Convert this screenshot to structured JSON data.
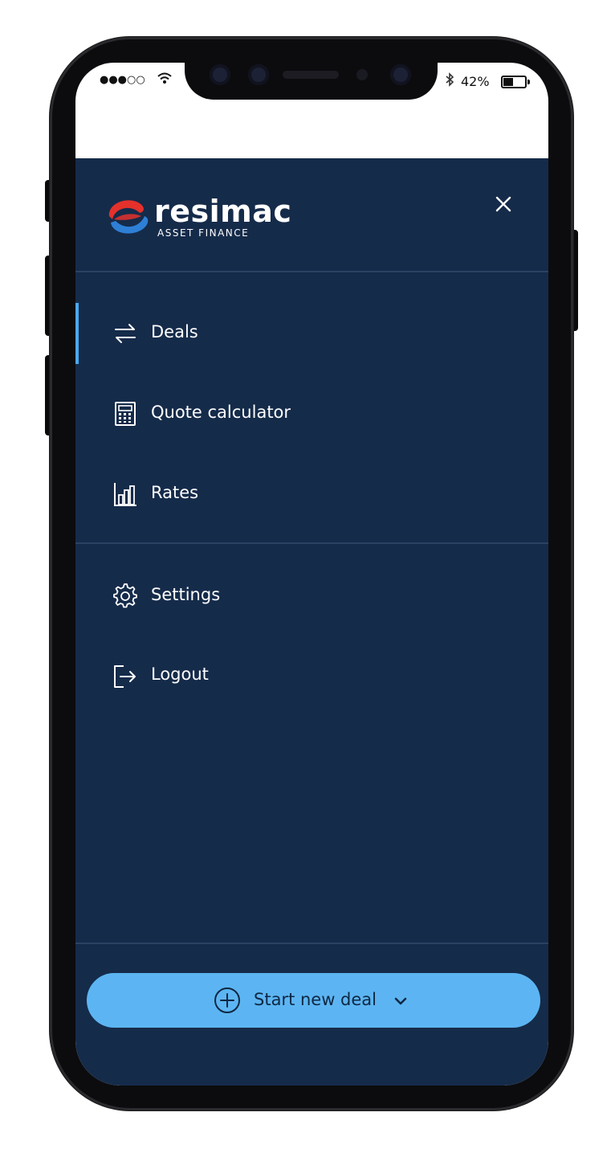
{
  "status_bar": {
    "signal": "●●●○○",
    "wifi_icon": "wifi-icon",
    "bluetooth_icon": "bluetooth-icon",
    "battery_percent": "42%"
  },
  "brand": {
    "name": "resimac",
    "subtitle": "ASSET FINANCE",
    "colors": {
      "red": "#e4312b",
      "blue": "#2e7fd6",
      "navy": "#152b4a"
    }
  },
  "drawer": {
    "close_icon": "close-icon",
    "menu": [
      {
        "label": "Deals",
        "icon": "swap-arrows-icon",
        "active": true
      },
      {
        "label": "Quote calculator",
        "icon": "calculator-icon",
        "active": false
      },
      {
        "label": "Rates",
        "icon": "bar-chart-icon",
        "active": false
      }
    ],
    "secondary": [
      {
        "label": "Settings",
        "icon": "gear-icon"
      },
      {
        "label": "Logout",
        "icon": "logout-icon"
      }
    ]
  },
  "cta": {
    "label": "Start new deal",
    "icon": "plus-circle-icon",
    "dropdown_icon": "chevron-down-icon",
    "color": "#5cb5f2"
  }
}
